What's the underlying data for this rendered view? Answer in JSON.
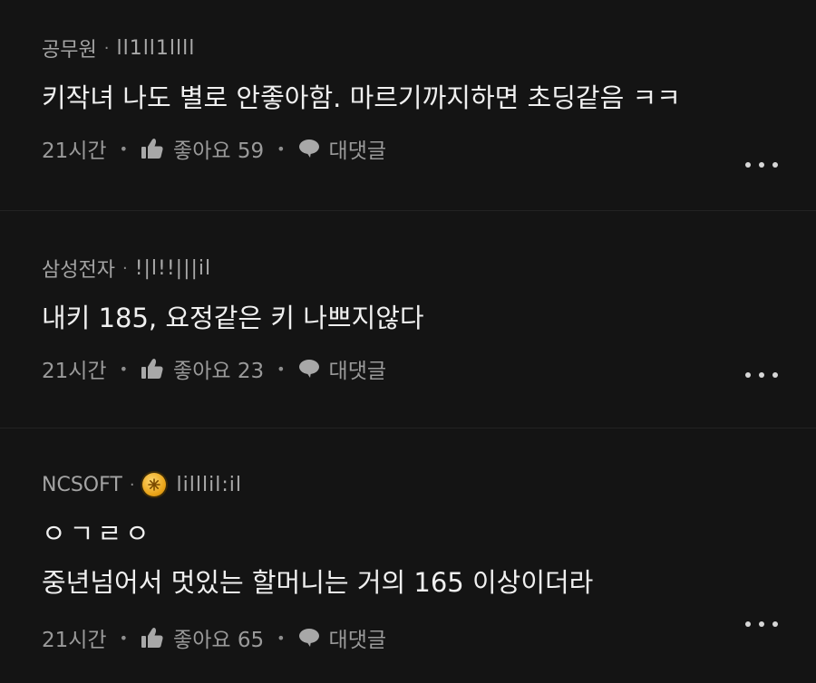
{
  "comments": [
    {
      "author": "공무원",
      "handle": "ll1ll1llll",
      "has_badge": false,
      "lines": [
        "키작녀 나도 별로 안좋아함. 마르기까지하면 초딩같음 ㅋㅋ"
      ],
      "time": "21시간",
      "like_label": "좋아요 59",
      "reply_label": "대댓글"
    },
    {
      "author": "삼성전자",
      "handle": "!|l!!|||il",
      "has_badge": false,
      "lines": [
        "내키 185, 요정같은 키 나쁘지않다"
      ],
      "time": "21시간",
      "like_label": "좋아요 23",
      "reply_label": "대댓글"
    },
    {
      "author": "NCSOFT",
      "handle": "lilllil:il",
      "has_badge": true,
      "lines": [
        "ㅇㄱㄹㅇ",
        "중년넘어서 멋있는 할머니는 거의 165 이상이더라"
      ],
      "time": "21시간",
      "like_label": "좋아요 65",
      "reply_label": "대댓글"
    }
  ],
  "icons": {
    "like": "thumbs-up-icon",
    "reply": "speech-bubble-icon",
    "more": "more-horizontal-icon",
    "badge": "gold-badge-icon"
  },
  "colors": {
    "background": "#141414",
    "badge": "#e9a317"
  }
}
